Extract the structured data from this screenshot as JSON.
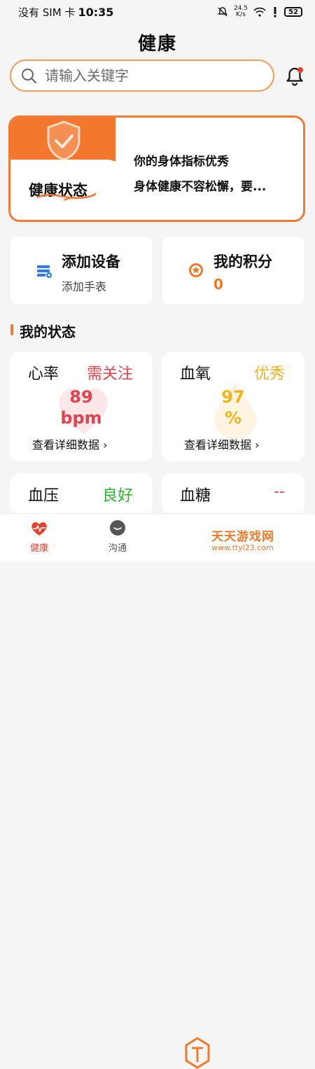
{
  "status_bar": {
    "carrier": "没有 SIM 卡",
    "time": "10:35",
    "net_speed_value": "24.5",
    "net_speed_unit": "K/s",
    "battery": "52"
  },
  "header": {
    "title": "健康"
  },
  "search": {
    "placeholder": "请输入关键字"
  },
  "health_status": {
    "title": "健康状态",
    "line1": "你的身体指标优秀",
    "line2": "身体健康不容松懈，要..."
  },
  "device_card": {
    "title": "添加设备",
    "subtitle": "添加手表"
  },
  "points_card": {
    "title": "我的积分",
    "value": "0"
  },
  "section": {
    "title": "我的状态"
  },
  "metrics": [
    {
      "label": "心率",
      "status": "需关注",
      "status_color": "#e0444e",
      "value": "89",
      "unit": "bpm",
      "value_color": "#e0444e",
      "link": "查看详细数据 ›"
    },
    {
      "label": "血氧",
      "status": "优秀",
      "status_color": "#f2b31c",
      "value": "97",
      "unit": "%",
      "value_color": "#f2b31c",
      "link": "查看详细数据 ›"
    },
    {
      "label": "血压",
      "status": "良好",
      "status_color": "#2bb12f"
    },
    {
      "label": "血糖",
      "status": "--",
      "status_color": "#e0444e"
    }
  ],
  "bottom_nav": [
    {
      "label": "健康",
      "active": true
    },
    {
      "label": "沟通",
      "active": false
    }
  ],
  "watermark": {
    "text": "天天游戏网",
    "url": "www.ttyl23.com"
  },
  "colors": {
    "accent": "#f37a35",
    "danger": "#e0444e",
    "warning": "#f2b31c",
    "good": "#2bb12f"
  }
}
